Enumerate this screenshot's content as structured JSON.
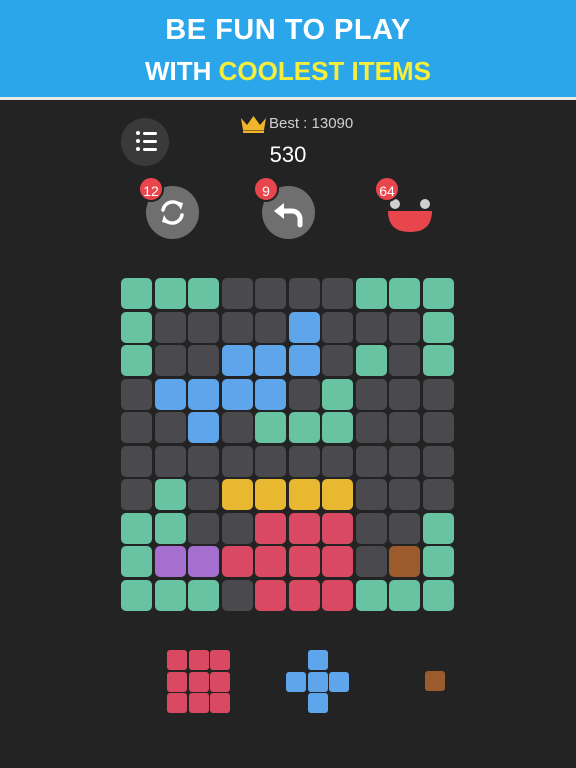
{
  "banner": {
    "line1": "BE FUN TO PLAY",
    "line2_prefix": "WITH ",
    "line2_highlight": "COOLEST ITEMS"
  },
  "best_label": "Best : 13090",
  "score": "530",
  "powerups": [
    {
      "name": "shuffle",
      "icon": "refresh-icon",
      "count": "12"
    },
    {
      "name": "undo",
      "icon": "undo-arrow-icon",
      "count": "9"
    },
    {
      "name": "bomb",
      "icon": "smiley-face-icon",
      "count": "64"
    }
  ],
  "colors": {
    "empty": "#4a4a4e",
    "teal": "#68c3a3",
    "blue": "#5ea5ec",
    "yellow": "#e8b830",
    "red": "#d94a62",
    "purple": "#a56fd0",
    "brown": "#9c5b2c"
  },
  "board": [
    "TTT....TTT",
    "T....B...T",
    "T..BBB.T.T",
    ".BBBB.T...",
    "..B.TTT...",
    "..........",
    ".T.YYYY...",
    "TT..RRR..T",
    "TPPRRRR.WT",
    "TTT.RRRTTT"
  ],
  "next_pieces": [
    {
      "color": "red",
      "cells": [
        [
          0,
          0
        ],
        [
          1,
          0
        ],
        [
          2,
          0
        ],
        [
          0,
          1
        ],
        [
          1,
          1
        ],
        [
          2,
          1
        ],
        [
          0,
          2
        ],
        [
          1,
          2
        ],
        [
          2,
          2
        ]
      ]
    },
    {
      "color": "blue",
      "cells": [
        [
          1,
          0
        ],
        [
          0,
          1
        ],
        [
          1,
          1
        ],
        [
          2,
          1
        ],
        [
          1,
          2
        ]
      ]
    },
    {
      "color": "brown",
      "cells": [
        [
          0,
          0
        ]
      ]
    }
  ]
}
